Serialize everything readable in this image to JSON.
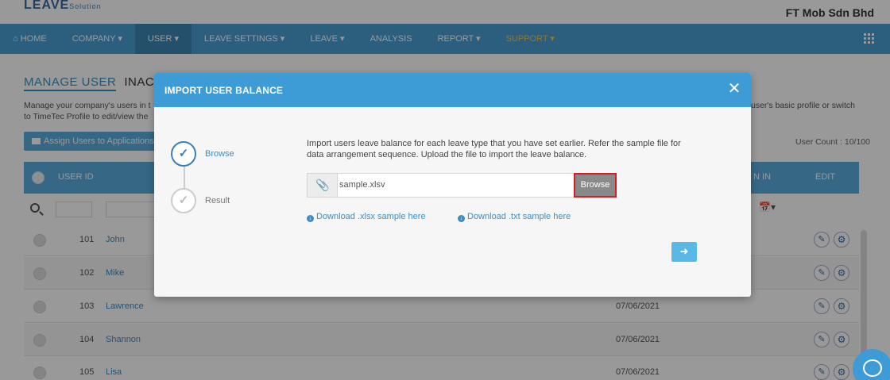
{
  "app": {
    "logo": "LEAVE",
    "logo_sub": "Solution",
    "company": "FT Mob Sdn Bhd"
  },
  "nav": {
    "items": [
      {
        "label": "⌂ HOME"
      },
      {
        "label": "COMPANY ▾"
      },
      {
        "label": "USER ▾"
      },
      {
        "label": "LEAVE SETTINGS ▾"
      },
      {
        "label": "LEAVE ▾"
      },
      {
        "label": "ANALYSIS"
      },
      {
        "label": "REPORT ▾"
      },
      {
        "label": "SUPPORT ▾"
      }
    ],
    "active_index": 2,
    "support_color": "#f3c64b"
  },
  "page": {
    "tab_manage": "MANAGE USER",
    "tab_inactive": "INACTI",
    "desc_line1": "Manage your company's users in t",
    "desc_line2": "to TimeTec Profile to edit/view the",
    "desc_right": "user's basic profile or switch",
    "assign_button": "Assign Users to Applications",
    "user_count": "User Count : 10/100"
  },
  "table": {
    "headers": {
      "user_id": "USER ID",
      "in": "N IN",
      "edit": "EDIT"
    },
    "rows": [
      {
        "id": "101",
        "name": "John",
        "date": ""
      },
      {
        "id": "102",
        "name": "Mike",
        "date": ""
      },
      {
        "id": "103",
        "name": "Lawrence",
        "date": "07/06/2021"
      },
      {
        "id": "104",
        "name": "Shannon",
        "date": "07/06/2021"
      },
      {
        "id": "105",
        "name": "Lisa",
        "date": "07/06/2021"
      }
    ]
  },
  "modal": {
    "title": "IMPORT USER BALANCE",
    "close": "✕",
    "steps": [
      {
        "label": "Browse",
        "icon": "check-icon",
        "state": "active"
      },
      {
        "label": "Result",
        "icon": "check-icon",
        "state": "inactive"
      }
    ],
    "instruction": "Import users leave balance for each leave type that you have set earlier. Refer the sample file for data arrangement sequence. Upload the file to import the leave balance.",
    "file_value": "sample.xlsv",
    "browse_label": "Browse",
    "download_xlsx": "Download .xlsx sample here",
    "download_txt": "Download .txt sample here",
    "next_icon": "arrow-right-icon"
  },
  "colors": {
    "nav_bg": "#4a9fd3",
    "modal_header": "#3d9bd6",
    "browse_border_highlight": "#d21f26",
    "link": "#3b8ec4"
  }
}
